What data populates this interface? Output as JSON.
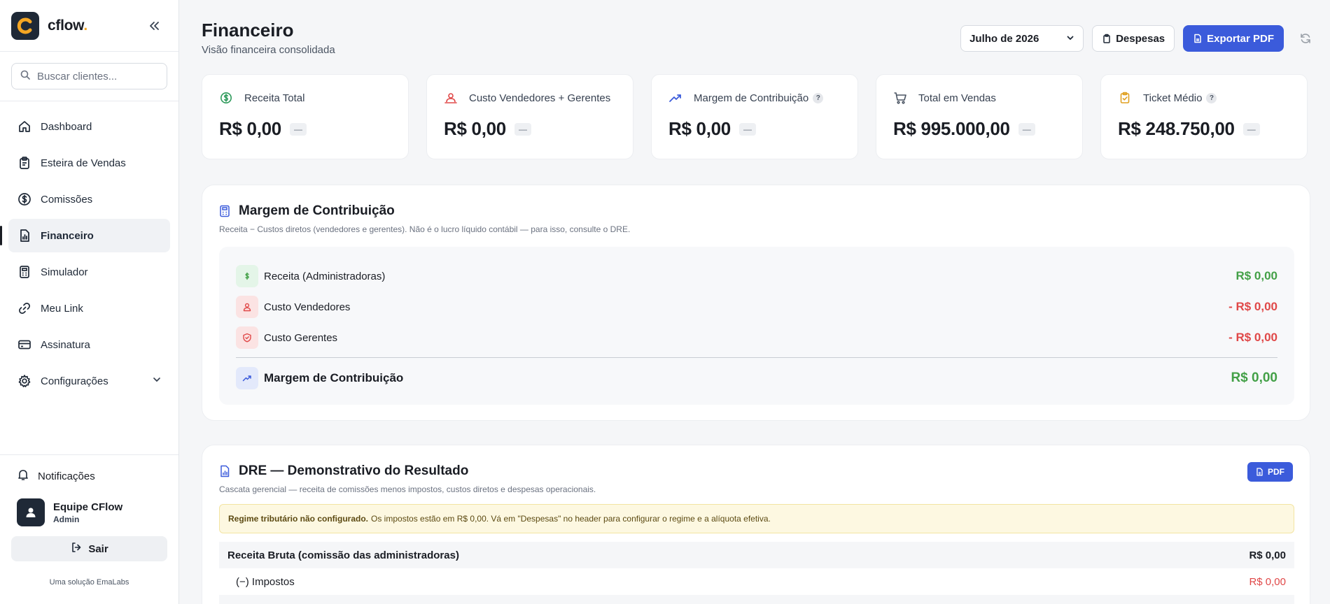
{
  "brand": {
    "name": "cflow",
    "dot": "."
  },
  "search": {
    "placeholder": "Buscar clientes..."
  },
  "nav": {
    "items": [
      {
        "label": "Dashboard"
      },
      {
        "label": "Esteira de Vendas"
      },
      {
        "label": "Comissões"
      },
      {
        "label": "Financeiro"
      },
      {
        "label": "Simulador"
      },
      {
        "label": "Meu Link"
      },
      {
        "label": "Assinatura"
      },
      {
        "label": "Configurações"
      }
    ]
  },
  "sidebar_bottom": {
    "notifications": "Notificações",
    "user_name": "Equipe CFlow",
    "user_role": "Admin",
    "logout": "Sair",
    "footer": "Uma solução EmaLabs"
  },
  "header": {
    "title": "Financeiro",
    "subtitle": "Visão financeira consolidada",
    "month": "Julho de 2026",
    "expenses_button": "Despesas",
    "export_button": "Exportar PDF"
  },
  "kpis": [
    {
      "label": "Receita Total",
      "value": "R$ 0,00",
      "badge": "—",
      "icon": "dollar-circle-icon"
    },
    {
      "label": "Custo Vendedores + Gerentes",
      "value": "R$ 0,00",
      "badge": "—",
      "icon": "users-icon"
    },
    {
      "label": "Margem de Contribuição",
      "value": "R$ 0,00",
      "badge": "—",
      "icon": "trend-up-icon",
      "help": "?"
    },
    {
      "label": "Total em Vendas",
      "value": "R$ 995.000,00",
      "badge": "—",
      "icon": "cart-icon"
    },
    {
      "label": "Ticket Médio",
      "value": "R$ 248.750,00",
      "badge": "—",
      "icon": "clipboard-check-icon",
      "help": "?"
    }
  ],
  "margin_card": {
    "title": "Margem de Contribuição",
    "subtitle": "Receita − Custos diretos (vendedores e gerentes). Não é o lucro líquido contábil — para isso, consulte o DRE.",
    "rows": [
      {
        "label": "Receita (Administradoras)",
        "value": "R$ 0,00"
      },
      {
        "label": "Custo Vendedores",
        "value": "- R$ 0,00"
      },
      {
        "label": "Custo Gerentes",
        "value": "- R$ 0,00"
      }
    ],
    "total_label": "Margem de Contribuição",
    "total_value": "R$ 0,00"
  },
  "dre_card": {
    "title": "DRE — Demonstrativo do Resultado",
    "subtitle": "Cascata gerencial — receita de comissões menos impostos, custos diretos e despesas operacionais.",
    "pdf_button": "PDF",
    "warning_bold": "Regime tributário não configurado.",
    "warning_text": "Os impostos estão em R$ 0,00. Vá em \"Despesas\" no header para configurar o regime e a alíquota efetiva.",
    "gross_label": "Receita Bruta (comissão das administradoras)",
    "gross_value": "R$ 0,00",
    "tax_label": "(−) Impostos",
    "tax_value": "R$ 0,00"
  },
  "colors": {
    "accent": "#3b5bdb",
    "positive": "#43a047",
    "negative": "#e04848",
    "brand_orange": "#f5a623"
  }
}
